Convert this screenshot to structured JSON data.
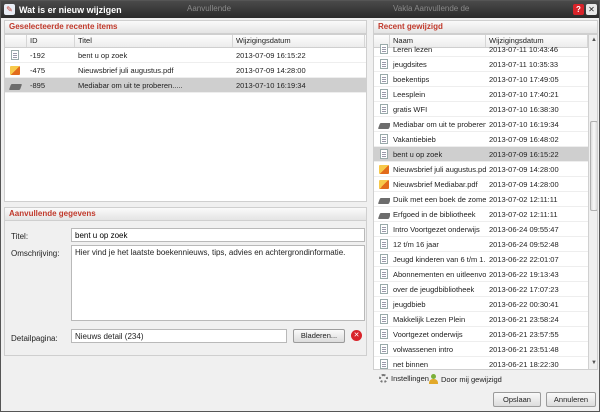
{
  "window": {
    "title": "Wat is er nieuw wijzigen",
    "ghost_left": "Aanvullende",
    "ghost_right": "Vakla Aanvullende de"
  },
  "left_grid": {
    "header": "Geselecteerde recente items",
    "columns": [
      "ID",
      "Titel",
      "Wijzigingsdatum"
    ],
    "rows": [
      {
        "icon": "document-icon",
        "id": "-192",
        "title": "bent u op zoek",
        "date": "2013-07-09 16:15:22"
      },
      {
        "icon": "pdf-icon",
        "id": "-475",
        "title": "Nieuwsbrief juli augustus.pdf",
        "date": "2013-07-09 14:28:00"
      },
      {
        "icon": "book-icon",
        "id": "-895",
        "title": "Mediabar om uit te proberen.....",
        "date": "2013-07-10 16:19:34"
      }
    ]
  },
  "details": {
    "header": "Aanvullende gegevens",
    "title_label": "Titel:",
    "title_value": "bent u op zoek",
    "desc_label": "Omschrijving:",
    "desc_value": "Hier vind je het laatste boekennieuws, tips, advies en achtergrondinformatie.",
    "detail_label": "Detailpagina:",
    "detail_value": "Nieuws detail (234)",
    "browse_label": "Bladeren..."
  },
  "right_grid": {
    "header": "Recent gewijzigd",
    "columns": [
      "Naam",
      "Wijzigingsdatum"
    ],
    "rows": [
      {
        "icon": "document-icon",
        "name": "Leren lezen",
        "date": "2013-07-11 10:43:46"
      },
      {
        "icon": "document-icon",
        "name": "jeugdsites",
        "date": "2013-07-11 10:35:33"
      },
      {
        "icon": "document-icon",
        "name": "boekentips",
        "date": "2013-07-10 17:49:05"
      },
      {
        "icon": "document-icon",
        "name": "Leesplein",
        "date": "2013-07-10 17:40:21"
      },
      {
        "icon": "document-icon",
        "name": "gratis WFI",
        "date": "2013-07-10 16:38:30"
      },
      {
        "icon": "book-icon",
        "name": "Mediabar om uit te proberen....",
        "date": "2013-07-10 16:19:34"
      },
      {
        "icon": "document-icon",
        "name": "Vakantiebieb",
        "date": "2013-07-09 16:48:02"
      },
      {
        "icon": "document-icon",
        "name": "bent u op zoek",
        "date": "2013-07-09 16:15:22"
      },
      {
        "icon": "pdf-icon",
        "name": "Nieuwsbrief juli augustus.pdf",
        "date": "2013-07-09 14:28:00"
      },
      {
        "icon": "pdf-icon",
        "name": "Nieuwsbrief Mediabar.pdf",
        "date": "2013-07-09 14:28:00"
      },
      {
        "icon": "book-icon",
        "name": "Duik met een boek de zome...",
        "date": "2013-07-02 12:11:11"
      },
      {
        "icon": "book-icon",
        "name": "Erfgoed in de bibliotheek",
        "date": "2013-07-02 12:11:11"
      },
      {
        "icon": "document-icon",
        "name": "Intro Voortgezet onderwijs",
        "date": "2013-06-24 09:55:47"
      },
      {
        "icon": "document-icon",
        "name": "12 t/m 16 jaar",
        "date": "2013-06-24 09:52:48"
      },
      {
        "icon": "document-icon",
        "name": "Jeugd kinderen van 6 t/m 1...",
        "date": "2013-06-22 22:01:07"
      },
      {
        "icon": "document-icon",
        "name": "Abonnementen en uitleenvo...",
        "date": "2013-06-22 19:13:43"
      },
      {
        "icon": "document-icon",
        "name": "over de jeugdbibliotheek",
        "date": "2013-06-22 17:07:23"
      },
      {
        "icon": "document-icon",
        "name": "jeugdbieb",
        "date": "2013-06-22 00:30:41"
      },
      {
        "icon": "document-icon",
        "name": "Makkelijk Lezen Plein",
        "date": "2013-06-21 23:58:24"
      },
      {
        "icon": "document-icon",
        "name": "Voortgezet onderwijs",
        "date": "2013-06-21 23:57:55"
      },
      {
        "icon": "document-icon",
        "name": "volwassenen intro",
        "date": "2013-06-21 23:51:48"
      },
      {
        "icon": "document-icon",
        "name": "net binnen",
        "date": "2013-06-21 18:22:30"
      }
    ],
    "selected_index": 7
  },
  "footer": {
    "settings_label": "Instellingen",
    "mine_label": "Door mij gewijzigd",
    "save_label": "Opslaan",
    "cancel_label": "Annuleren"
  }
}
